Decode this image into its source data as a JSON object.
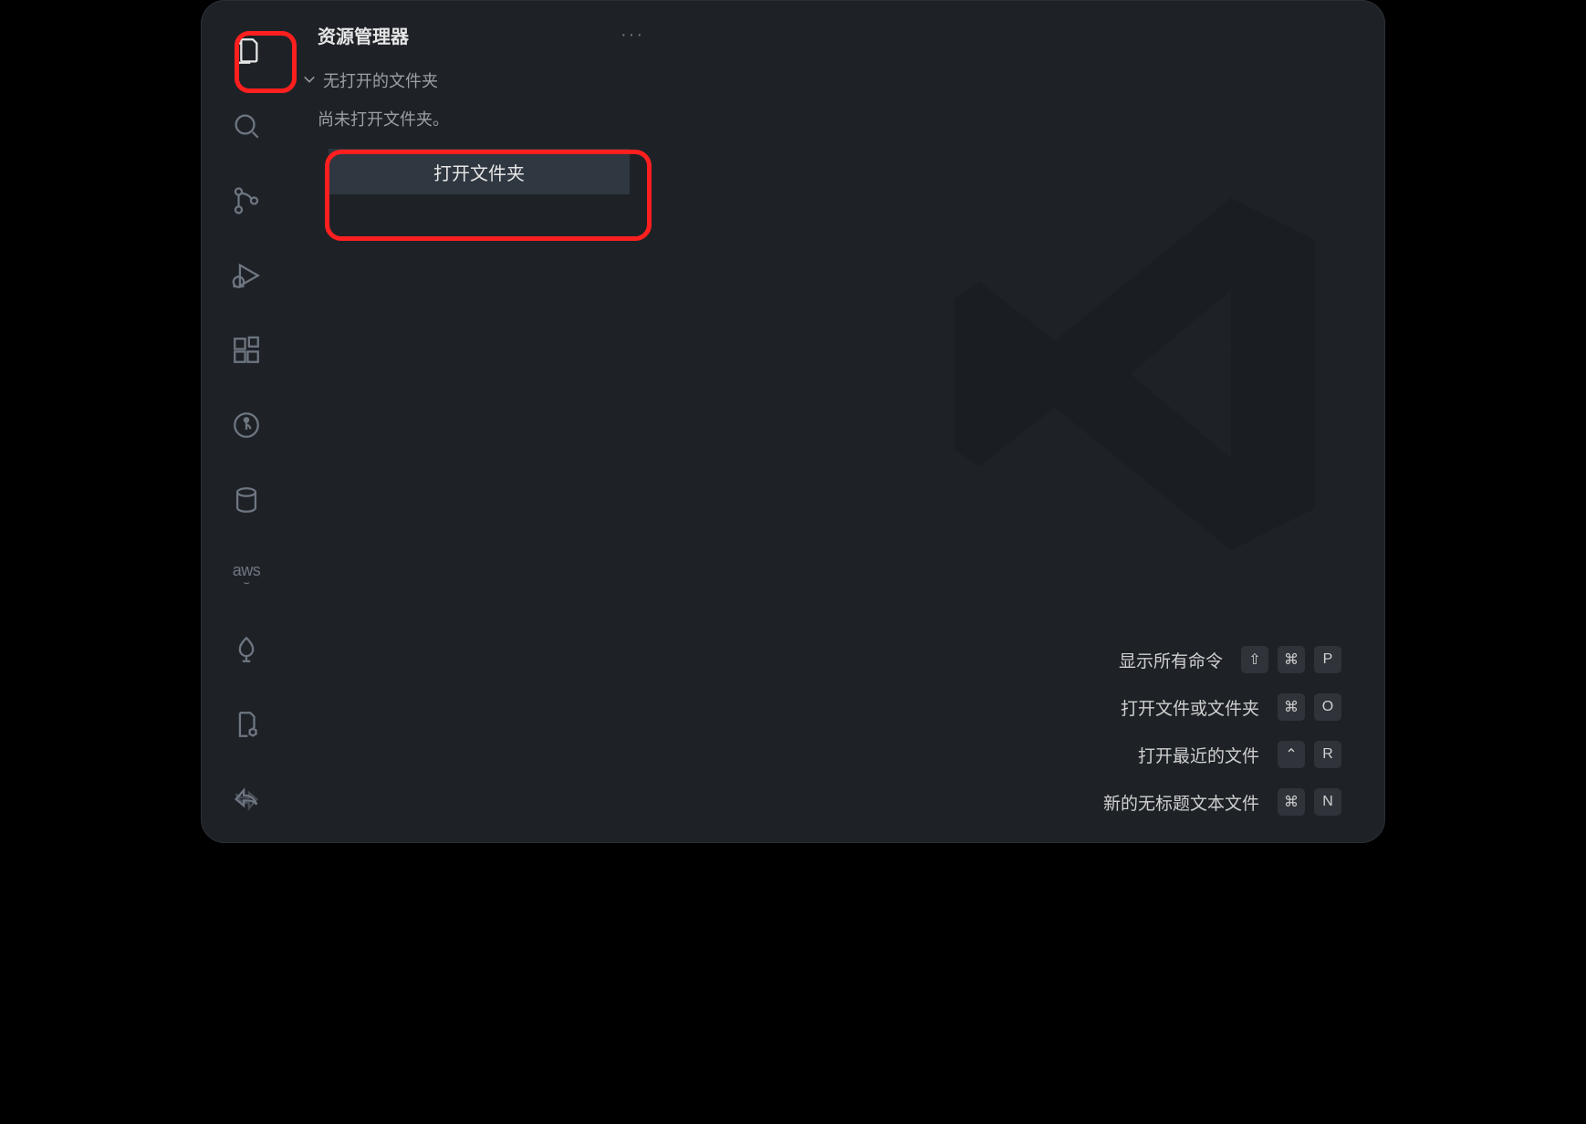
{
  "sidebar": {
    "title": "资源管理器",
    "section_label": "无打开的文件夹",
    "no_folder_text": "尚未打开文件夹。",
    "open_folder_label": "打开文件夹"
  },
  "shortcuts": {
    "show_commands": {
      "label": "显示所有命令",
      "keys": [
        "⇧",
        "⌘",
        "P"
      ]
    },
    "open_file": {
      "label": "打开文件或文件夹",
      "keys": [
        "⌘",
        "O"
      ]
    },
    "open_recent": {
      "label": "打开最近的文件",
      "keys": [
        "⌃",
        "R"
      ]
    },
    "new_untitled": {
      "label": "新的无标题文本文件",
      "keys": [
        "⌘",
        "N"
      ]
    }
  },
  "activitybar": {
    "items": [
      {
        "name": "explorer",
        "active": true
      },
      {
        "name": "search",
        "active": false
      },
      {
        "name": "source-control",
        "active": false
      },
      {
        "name": "run-debug",
        "active": false
      },
      {
        "name": "extensions",
        "active": false
      },
      {
        "name": "git-graph",
        "active": false
      },
      {
        "name": "database",
        "active": false
      },
      {
        "name": "aws",
        "active": false
      },
      {
        "name": "tree",
        "active": false
      },
      {
        "name": "file-settings",
        "active": false
      },
      {
        "name": "sync",
        "active": false
      }
    ],
    "aws_label": "aws"
  },
  "highlights": {
    "explorer_icon": true,
    "open_folder_button": true
  }
}
